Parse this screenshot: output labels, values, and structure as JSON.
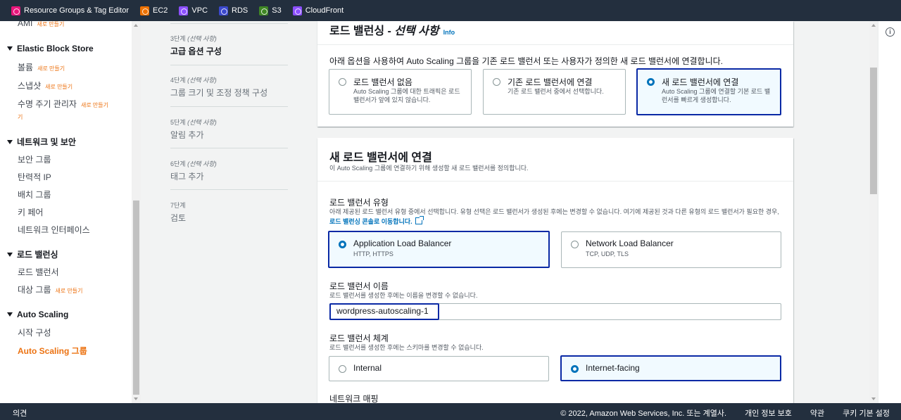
{
  "favorites": [
    {
      "label": "Resource Groups & Tag Editor",
      "icon": "resource-groups-icon",
      "color": "#e7157b"
    },
    {
      "label": "EC2",
      "icon": "ec2-icon",
      "color": "#ed7100"
    },
    {
      "label": "VPC",
      "icon": "vpc-icon",
      "color": "#8c4fff"
    },
    {
      "label": "RDS",
      "icon": "rds-icon",
      "color": "#3b48cc"
    },
    {
      "label": "S3",
      "icon": "s3-icon",
      "color": "#3f8624"
    },
    {
      "label": "CloudFront",
      "icon": "cloudfront-icon",
      "color": "#8c4fff"
    }
  ],
  "sidenav": {
    "ami": "AMI",
    "new_badge": "새로 만들기",
    "ebs": {
      "title": "Elastic Block Store",
      "items": [
        "볼륨",
        "스냅샷",
        "수명 주기 관리자"
      ]
    },
    "lifecycle_badge_tail": "기",
    "network": {
      "title": "네트워크 및 보안",
      "items": [
        "보안 그룹",
        "탄력적 IP",
        "배치 그룹",
        "키 페어",
        "네트워크 인터페이스"
      ]
    },
    "lb": {
      "title": "로드 밸런싱",
      "items": [
        "로드 밸런서",
        "대상 그룹"
      ]
    },
    "asg": {
      "title": "Auto Scaling",
      "items": [
        "시작 구성",
        "Auto Scaling 그룹"
      ]
    }
  },
  "steps": [
    {
      "num": "3단계",
      "opt": "(선택 사항)",
      "title": "고급 옵션 구성",
      "current": true
    },
    {
      "num": "4단계",
      "opt": "(선택 사항)",
      "title": "그룹 크기 및 조정 정책 구성"
    },
    {
      "num": "5단계",
      "opt": "(선택 사항)",
      "title": "알림 추가"
    },
    {
      "num": "6단계",
      "opt": "(선택 사항)",
      "title": "태그 추가"
    },
    {
      "num": "7단계",
      "opt": "",
      "title": "검토"
    }
  ],
  "lb_panel": {
    "title": "로드 밸런싱 - ",
    "title_italic": "선택 사항",
    "info": "Info",
    "description": "아래 옵션을 사용하여 Auto Scaling 그룹을 기존 로드 밸런서 또는 사용자가 정의한 새 로드 밸런서에 연결합니다.",
    "options": [
      {
        "title": "로드 밸런서 없음",
        "desc": "Auto Scaling 그룹에 대한 트래픽은 로드 밸런서가 앞에 있지 않습니다.",
        "selected": false
      },
      {
        "title": "기존 로드 밸런서에 연결",
        "desc": "기존 로드 밸런서 중에서 선택합니다.",
        "selected": false
      },
      {
        "title": "새 로드 밸런서에 연결",
        "desc": "Auto Scaling 그룹에 연결할 기본 로드 밸런서를 빠르게 생성합니다.",
        "selected": true
      }
    ]
  },
  "new_lb": {
    "title": "새 로드 밸런서에 연결",
    "subtitle": "이 Auto Scaling 그룹에 연결하기 위해 생성할 새 로드 밸런서를 정의합니다.",
    "type_label": "로드 밸런서 유형",
    "type_desc": "아래 제공된 로드 밸런서 유형 중에서 선택합니다. 유형 선택은 로드 밸런서가 생성된 후에는 변경할 수 없습니다. 여기에 제공된 것과 다른 유형의 로드 밸런서가 필요한 경우, ",
    "console_link": "로드 밸런싱 콘솔로 이동합니다.",
    "types": [
      {
        "title": "Application Load Balancer",
        "desc": "HTTP, HTTPS",
        "selected": true
      },
      {
        "title": "Network Load Balancer",
        "desc": "TCP, UDP, TLS",
        "selected": false
      }
    ],
    "name_label": "로드 밸런서 이름",
    "name_desc": "로드 밸런서를 생성한 후에는 이름을 변경할 수 없습니다.",
    "name_value": "wordpress-autoscaling-1",
    "scheme_label": "로드 밸런서 체계",
    "scheme_desc": "로드 밸런서를 생성한 후에는 스키마를 변경할 수 없습니다.",
    "schemes": [
      {
        "title": "Internal",
        "selected": false
      },
      {
        "title": "Internet-facing",
        "selected": true
      }
    ],
    "network_mapping": "네트워크 매핑"
  },
  "footer": {
    "feedback": "의견",
    "copyright": "© 2022, Amazon Web Services, Inc. 또는 계열사.",
    "privacy": "개인 정보 보호",
    "terms": "약관",
    "cookies": "쿠키 기본 설정"
  },
  "colors": {
    "accent": "#ec7211",
    "selected_border": "#0a29a5",
    "link": "#0073bb",
    "header_bg": "#232f3e"
  }
}
